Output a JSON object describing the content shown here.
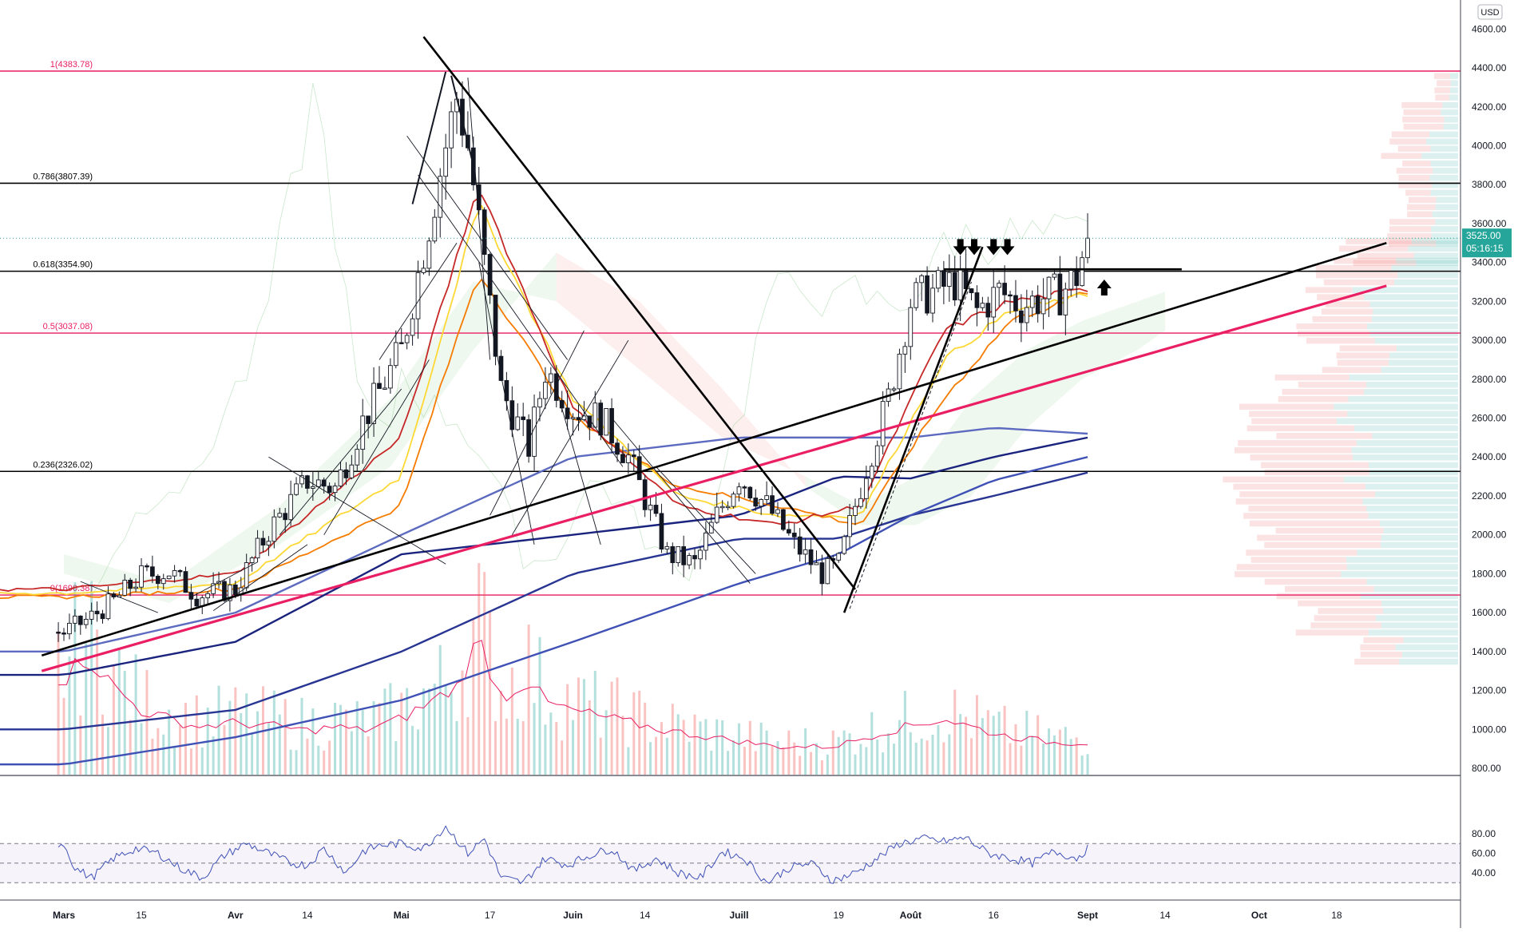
{
  "currency": "USD",
  "chart_data": {
    "type": "line",
    "price_axis": {
      "ticks": [
        "4600.00",
        "4400.00",
        "4200.00",
        "4000.00",
        "3800.00",
        "3600.00",
        "3400.00",
        "3200.00",
        "3000.00",
        "2800.00",
        "2600.00",
        "2400.00",
        "2200.00",
        "2000.00",
        "1800.00",
        "1600.00",
        "1400.00",
        "1200.00",
        "1000.00",
        "800.00"
      ],
      "tick_values": [
        4600,
        4400,
        4200,
        4000,
        3800,
        3600,
        3400,
        3200,
        3000,
        2800,
        2600,
        2400,
        2200,
        2000,
        1800,
        1600,
        1400,
        1200,
        1000,
        800
      ],
      "ylim": [
        750,
        4700
      ]
    },
    "time_axis": {
      "ticks": [
        "Mars",
        "15",
        "Avr",
        "14",
        "Mai",
        "17",
        "Juin",
        "14",
        "Juill",
        "19",
        "Août",
        "16",
        "Sept",
        "14",
        "Oct",
        "18"
      ],
      "tick_days": [
        1,
        15,
        32,
        45,
        62,
        78,
        93,
        106,
        123,
        141,
        154,
        169,
        186,
        200,
        217,
        231
      ]
    },
    "current_price": {
      "value": 3525,
      "label": "3525.00",
      "countdown": "05:16:15",
      "color": "#26a69a"
    },
    "fibonacci": [
      {
        "label": "1(4383.78)",
        "value": 4383.78,
        "color": "#e91e63"
      },
      {
        "label": "0.786(3807.39)",
        "value": 3807.39,
        "color": "#000000"
      },
      {
        "label": "0.618(3354.90)",
        "value": 3354.9,
        "color": "#000000"
      },
      {
        "label": "0.5(3037.08)",
        "value": 3037.08,
        "color": "#e91e63"
      },
      {
        "label": "0.236(2326.02)",
        "value": 2326.02,
        "color": "#000000"
      },
      {
        "label": "0(1690.38)",
        "value": 1690.38,
        "color": "#e91e63"
      }
    ],
    "close_series": {
      "x_days": [
        1,
        5,
        10,
        15,
        20,
        25,
        32,
        38,
        45,
        50,
        55,
        62,
        67,
        70,
        72,
        74,
        76,
        80,
        85,
        88,
        93,
        98,
        103,
        110,
        115,
        119,
        123,
        128,
        133,
        138,
        141,
        146,
        150,
        154,
        158,
        162,
        166,
        170,
        174,
        178,
        181,
        184,
        186
      ],
      "values": [
        1500,
        1560,
        1660,
        1790,
        1810,
        1690,
        1720,
        2020,
        2280,
        2240,
        2580,
        2950,
        3600,
        4000,
        4250,
        4000,
        3600,
        2750,
        2450,
        2850,
        2650,
        2600,
        2400,
        1900,
        1850,
        2100,
        2300,
        2150,
        1950,
        1800,
        1850,
        2350,
        2700,
        3200,
        3250,
        3300,
        3150,
        3250,
        3180,
        3220,
        3240,
        3330,
        3525
      ]
    },
    "sma_series": [
      {
        "name": "",
        "color": "#1a237e",
        "values": [
          1280,
          1450,
          1900,
          2000,
          2100,
          2300,
          2290,
          2400,
          2500
        ]
      },
      {
        "name": "",
        "color": "#5c6bc0",
        "values": [
          1400,
          1600,
          2000,
          2400,
          2500,
          2500,
          2500,
          2550,
          2520
        ]
      },
      {
        "name": "",
        "color": "#283593",
        "values": [
          1000,
          1100,
          1400,
          1800,
          1980,
          1980,
          2100,
          2200,
          2320
        ]
      },
      {
        "name": "",
        "color": "#3f51b5",
        "values": [
          820,
          960,
          1150,
          1450,
          1750,
          1900,
          2100,
          2280,
          2400
        ]
      }
    ],
    "sma_x_days": [
      1,
      32,
      62,
      93,
      123,
      141,
      154,
      169,
      186
    ],
    "ema_series": [
      {
        "name": "",
        "color": "#f57c00",
        "values": [
          1680,
          1720,
          2150,
          3350,
          2600,
          2250,
          2150,
          2050,
          2700,
          3100,
          3250
        ]
      },
      {
        "name": "",
        "color": "#fdd835",
        "values": [
          1700,
          1750,
          2300,
          3700,
          2700,
          2200,
          2100,
          2100,
          2900,
          3150,
          3230
        ]
      },
      {
        "name": "",
        "color": "#c62828",
        "values": [
          1720,
          1800,
          2500,
          3800,
          2650,
          2150,
          2050,
          2150,
          3050,
          3200,
          3260
        ]
      }
    ],
    "ema_x_days": [
      1,
      32,
      62,
      76,
      93,
      112,
      130,
      145,
      160,
      172,
      186
    ],
    "trend_lines": [
      {
        "color": "#000000",
        "from": [
          -3,
          1380
        ],
        "to": [
          240,
          3500
        ]
      },
      {
        "color": "#e91e63",
        "from": [
          -3,
          1300
        ],
        "to": [
          240,
          3280
        ]
      },
      {
        "color": "#000000",
        "from": [
          66,
          4560
        ],
        "to": [
          144,
          1720
        ]
      },
      {
        "color": "#000000",
        "from": [
          142,
          1600
        ],
        "to": [
          167,
          3480
        ]
      },
      {
        "color": "#000000",
        "from": [
          160,
          3365
        ],
        "to": [
          203,
          3365
        ]
      }
    ],
    "resistance_arrows_x": [
      163,
      165.5,
      169,
      171.5
    ],
    "support_arrow_x": [
      189
    ],
    "volume_profile": [
      {
        "price": 4300,
        "sell": 20,
        "buy": 10
      },
      {
        "price": 4150,
        "sell": 50,
        "buy": 20
      },
      {
        "price": 4000,
        "sell": 45,
        "buy": 40
      },
      {
        "price": 3850,
        "sell": 40,
        "buy": 35
      },
      {
        "price": 3700,
        "sell": 35,
        "buy": 30
      },
      {
        "price": 3550,
        "sell": 60,
        "buy": 30
      },
      {
        "price": 3450,
        "sell": 80,
        "buy": 60
      },
      {
        "price": 3350,
        "sell": 90,
        "buy": 80
      },
      {
        "price": 3200,
        "sell": 60,
        "buy": 120
      },
      {
        "price": 3050,
        "sell": 80,
        "buy": 100
      },
      {
        "price": 2900,
        "sell": 70,
        "buy": 90
      },
      {
        "price": 2750,
        "sell": 100,
        "buy": 120
      },
      {
        "price": 2600,
        "sell": 120,
        "buy": 140
      },
      {
        "price": 2450,
        "sell": 140,
        "buy": 120
      },
      {
        "price": 2300,
        "sell": 150,
        "buy": 130
      },
      {
        "price": 2150,
        "sell": 170,
        "buy": 120
      },
      {
        "price": 2000,
        "sell": 150,
        "buy": 110
      },
      {
        "price": 1850,
        "sell": 140,
        "buy": 130
      },
      {
        "price": 1700,
        "sell": 120,
        "buy": 110
      },
      {
        "price": 1550,
        "sell": 90,
        "buy": 100
      },
      {
        "price": 1400,
        "sell": 50,
        "buy": 70
      }
    ],
    "volume_ma": {
      "x_days": [
        1,
        5,
        10,
        15,
        20,
        25,
        32,
        40,
        45,
        50,
        55,
        62,
        67,
        72,
        76,
        80,
        85,
        88,
        93,
        100,
        110,
        120,
        130,
        140,
        150,
        160,
        170,
        180,
        186
      ],
      "values": [
        120,
        150,
        110,
        80,
        70,
        60,
        65,
        60,
        55,
        60,
        55,
        70,
        90,
        110,
        170,
        95,
        120,
        90,
        80,
        70,
        55,
        45,
        35,
        35,
        55,
        70,
        50,
        40,
        40
      ]
    },
    "rsi": {
      "ticks": [
        "80.00",
        "60.00",
        "40.00"
      ],
      "tick_values": [
        80,
        60,
        40
      ],
      "ylim": [
        22,
        89
      ],
      "bands": [
        70,
        50,
        30
      ],
      "x_days": [
        1,
        3,
        6,
        10,
        14,
        18,
        22,
        26,
        30,
        34,
        38,
        42,
        45,
        48,
        52,
        55,
        58,
        62,
        66,
        70,
        74,
        77,
        80,
        84,
        88,
        92,
        96,
        100,
        104,
        108,
        112,
        116,
        120,
        124,
        128,
        132,
        136,
        140,
        144,
        148,
        152,
        156,
        160,
        164,
        168,
        172,
        176,
        180,
        184,
        186
      ],
      "values": [
        70,
        45,
        35,
        55,
        65,
        60,
        45,
        35,
        58,
        70,
        60,
        50,
        48,
        65,
        40,
        62,
        68,
        70,
        65,
        88,
        60,
        75,
        35,
        30,
        55,
        48,
        58,
        65,
        42,
        55,
        40,
        35,
        62,
        55,
        30,
        45,
        50,
        32,
        40,
        55,
        70,
        75,
        72,
        76,
        60,
        55,
        50,
        62,
        55,
        65
      ],
      "color": "#3f51b5"
    }
  }
}
